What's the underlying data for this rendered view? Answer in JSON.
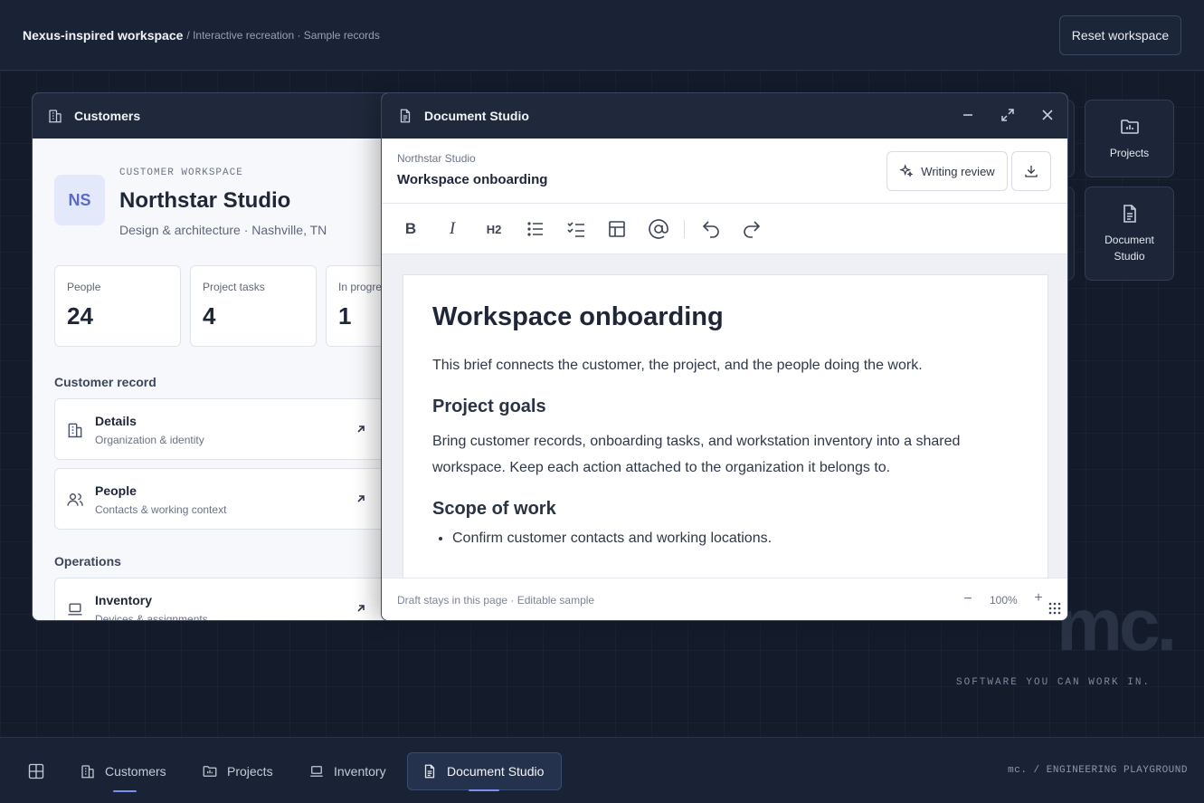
{
  "topbar": {
    "brand": "Nexus-inspired workspace",
    "subtitle": "/ Interactive recreation · Sample records",
    "reset_label": "Reset workspace"
  },
  "launcher": {
    "projects_label": "Projects",
    "docstudio_label_line1": "Document",
    "docstudio_label_line2": "Studio"
  },
  "watermark": "mc.",
  "tagline": "SOFTWARE YOU CAN WORK IN.",
  "customers_window": {
    "title": "Customers",
    "avatar_initials": "NS",
    "kicker": "CUSTOMER WORKSPACE",
    "name": "Northstar Studio",
    "description": "Design & architecture · Nashville, TN",
    "stats": [
      {
        "label": "People",
        "value": "24"
      },
      {
        "label": "Project tasks",
        "value": "4"
      },
      {
        "label": "In progre",
        "value": "1"
      }
    ],
    "section_record": "Customer record",
    "records": [
      {
        "title": "Details",
        "subtitle": "Organization & identity"
      },
      {
        "title": "People",
        "subtitle": "Contacts & working context"
      }
    ],
    "section_ops": "Operations",
    "ops": [
      {
        "title": "Inventory",
        "subtitle": "Devices & assignments"
      }
    ]
  },
  "doc_window": {
    "title": "Document Studio",
    "org": "Northstar Studio",
    "doc_title": "Workspace onboarding",
    "writing_review": "Writing review",
    "tools": {
      "bold": "B",
      "italic": "I",
      "heading": "H2"
    },
    "content": {
      "h1": "Workspace onboarding",
      "intro": "This brief connects the customer, the project, and the people doing the work.",
      "h2_goals": "Project goals",
      "goals": "Bring customer records, onboarding tasks, and workstation inventory into a shared workspace. Keep each action attached to the organization it belongs to.",
      "h2_scope": "Scope of work",
      "scope_items": [
        "Confirm customer contacts and working locations."
      ]
    },
    "footer_note": "Draft stays in this page · Editable sample",
    "zoom": "100%"
  },
  "taskbar": {
    "items": [
      {
        "label": "Customers"
      },
      {
        "label": "Projects"
      },
      {
        "label": "Inventory"
      },
      {
        "label": "Document Studio"
      }
    ],
    "right_text": "mc. / ENGINEERING PLAYGROUND"
  },
  "colors": {
    "accent": "#7a8ff0",
    "window_header": "#1f293b",
    "background": "#141c2c"
  }
}
